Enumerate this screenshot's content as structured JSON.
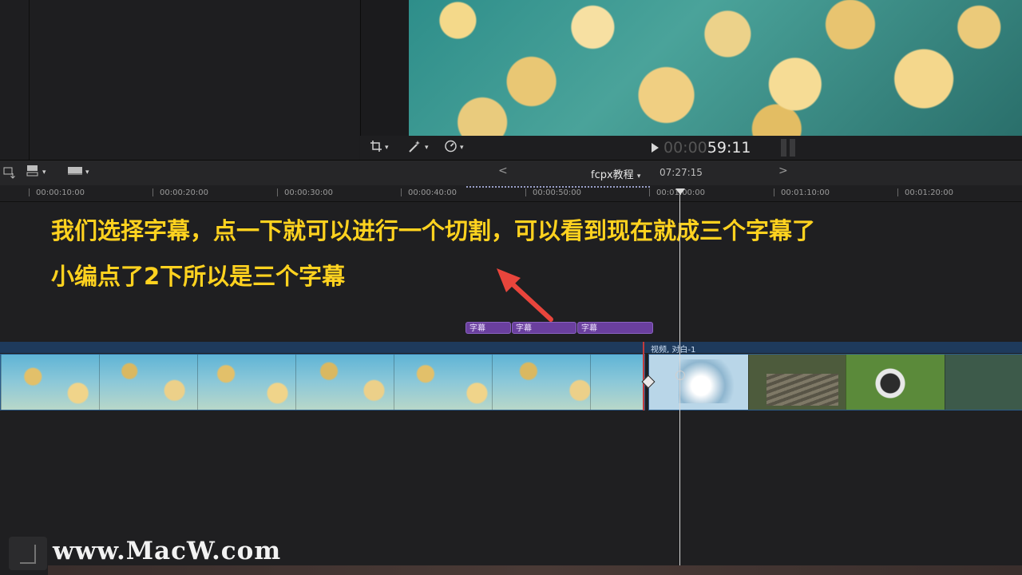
{
  "viewer": {
    "timecode_dim": "00:00",
    "timecode_bright": "59:11",
    "tools": [
      "crop-icon",
      "magic-wand-icon",
      "speedometer-icon"
    ]
  },
  "timeline": {
    "project_name": "fcpx教程",
    "project_duration": "07:27:15",
    "ruler_labels": [
      "00:00:10:00",
      "00:00:20:00",
      "00:00:30:00",
      "00:00:40:00",
      "00:00:50:00",
      "00:01:00:00",
      "00:01:10:00",
      "00:01:20:00"
    ],
    "subtitle_clips": [
      "字幕",
      "字幕",
      "字幕"
    ],
    "storyline_label": "视频, 对白-1"
  },
  "overlay": {
    "caption_line1": "我们选择字幕，点一下就可以进行一个切割，可以看到现在就成三个字幕了",
    "caption_line2": "小编点了2下所以是三个字幕",
    "caption_color": "#ffd21f",
    "arrow_color": "#e8453c"
  },
  "watermark": {
    "text": "www.MacW.com"
  }
}
